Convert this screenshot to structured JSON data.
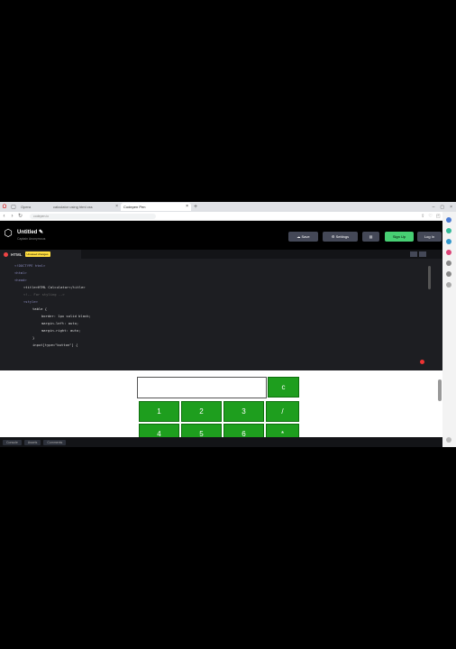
{
  "browser": {
    "tabs": [
      {
        "label": "Opera",
        "active": false
      },
      {
        "label": "calculator using html css",
        "active": false
      },
      {
        "label": "Codepen Pen",
        "active": true
      }
    ],
    "url": "codepen.io",
    "new_tab": "+"
  },
  "codepen": {
    "title": "Untitled",
    "subtitle": "Captain Anonymous",
    "buttons": {
      "save": "Save",
      "settings": "Settings",
      "signup": "Sign Up",
      "login": "Log In"
    }
  },
  "editor": {
    "tab_label": "HTML",
    "badge": "Unsaved changes",
    "lines": [
      {
        "indent": 0,
        "text": "<!DOCTYPE html>",
        "cls": "c-tag"
      },
      {
        "indent": 0,
        "text": "<html>",
        "cls": "c-tag"
      },
      {
        "indent": 0,
        "text": "",
        "cls": ""
      },
      {
        "indent": 0,
        "text": "<head>",
        "cls": "c-tag"
      },
      {
        "indent": 1,
        "text": "<title>HTML Calculator</title>",
        "cls": "c-str"
      },
      {
        "indent": 0,
        "text": "",
        "cls": ""
      },
      {
        "indent": 1,
        "text": "<!-- For styling -->",
        "cls": "c-com"
      },
      {
        "indent": 1,
        "text": "<style>",
        "cls": "c-tag"
      },
      {
        "indent": 2,
        "text": "table {",
        "cls": "c-str"
      },
      {
        "indent": 3,
        "text": "border: 1px solid black;",
        "cls": "c-str"
      },
      {
        "indent": 3,
        "text": "margin-left: auto;",
        "cls": "c-str"
      },
      {
        "indent": 3,
        "text": "margin-right: auto;",
        "cls": "c-str"
      },
      {
        "indent": 2,
        "text": "}",
        "cls": "c-str"
      },
      {
        "indent": 0,
        "text": "",
        "cls": ""
      },
      {
        "indent": 2,
        "text": "input[type=\"button\"] {",
        "cls": "c-str"
      }
    ]
  },
  "calculator": {
    "clear": "c",
    "row1": [
      "1",
      "2",
      "3",
      "/"
    ],
    "row2": [
      "4",
      "5",
      "6",
      "*"
    ]
  },
  "bottom_bar": [
    "Console",
    "Assets",
    "Comments"
  ]
}
